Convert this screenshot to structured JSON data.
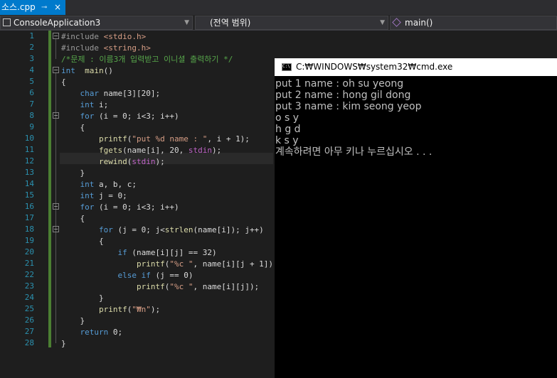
{
  "tab": {
    "file_name": "소스.cpp",
    "pin_glyph": "⊸",
    "close_glyph": "×"
  },
  "navbar": {
    "project": "ConsoleApplication3",
    "scope": "(전역 범위)",
    "member": "main()"
  },
  "editor": {
    "line_numbers": [
      "1",
      "2",
      "3",
      "4",
      "5",
      "6",
      "7",
      "8",
      "9",
      "10",
      "11",
      "12",
      "13",
      "14",
      "15",
      "16",
      "17",
      "18",
      "19",
      "20",
      "21",
      "22",
      "23",
      "24",
      "25",
      "26",
      "27",
      "28"
    ],
    "lines": [
      [
        [
          "inc",
          "#include "
        ],
        [
          "str",
          "<stdio.h>"
        ]
      ],
      [
        [
          "inc",
          "#include "
        ],
        [
          "str",
          "<string.h>"
        ]
      ],
      [
        [
          "cm",
          "/*문제 : 이름3개 입력받고 이니셜 출력하기 */"
        ]
      ],
      [
        [
          "kw",
          "int"
        ],
        [
          "",
          "  "
        ],
        [
          "fn",
          "main"
        ],
        [
          "",
          "()"
        ]
      ],
      [
        [
          "",
          "{"
        ]
      ],
      [
        [
          "",
          "    "
        ],
        [
          "kw",
          "char"
        ],
        [
          "",
          " name[3][20];"
        ]
      ],
      [
        [
          "",
          "    "
        ],
        [
          "kw",
          "int"
        ],
        [
          "",
          " i;"
        ]
      ],
      [
        [
          "",
          "    "
        ],
        [
          "kw",
          "for"
        ],
        [
          "",
          " (i = 0; i<3; i++)"
        ]
      ],
      [
        [
          "",
          "    {"
        ]
      ],
      [
        [
          "",
          "        "
        ],
        [
          "fn",
          "printf"
        ],
        [
          "",
          "("
        ],
        [
          "str",
          "\"put %d name : \""
        ],
        [
          "",
          ", i + 1);"
        ]
      ],
      [
        [
          "",
          "        "
        ],
        [
          "fn",
          "fgets"
        ],
        [
          "",
          "(name[i], 20, "
        ],
        [
          "mac",
          "stdin"
        ],
        [
          "",
          ");"
        ]
      ],
      [
        [
          "",
          "        "
        ],
        [
          "fn",
          "rewind"
        ],
        [
          "",
          "("
        ],
        [
          "mac",
          "stdin"
        ],
        [
          "",
          ");"
        ]
      ],
      [
        [
          "",
          "    }"
        ]
      ],
      [
        [
          "",
          "    "
        ],
        [
          "kw",
          "int"
        ],
        [
          "",
          " a, b, c;"
        ]
      ],
      [
        [
          "",
          "    "
        ],
        [
          "kw",
          "int"
        ],
        [
          "",
          " j = 0;"
        ]
      ],
      [
        [
          "",
          "    "
        ],
        [
          "kw",
          "for"
        ],
        [
          "",
          " (i = 0; i<3; i++)"
        ]
      ],
      [
        [
          "",
          "    {"
        ]
      ],
      [
        [
          "",
          "        "
        ],
        [
          "kw",
          "for"
        ],
        [
          "",
          " (j = 0; j<"
        ],
        [
          "fn",
          "strlen"
        ],
        [
          "",
          "(name[i]); j++)"
        ]
      ],
      [
        [
          "",
          "        {"
        ]
      ],
      [
        [
          "",
          "            "
        ],
        [
          "kw",
          "if"
        ],
        [
          "",
          " (name[i][j] == 32)"
        ]
      ],
      [
        [
          "",
          "                "
        ],
        [
          "fn",
          "printf"
        ],
        [
          "",
          "("
        ],
        [
          "str",
          "\"%c \""
        ],
        [
          "",
          ", name[i][j + 1]);"
        ]
      ],
      [
        [
          "",
          "            "
        ],
        [
          "kw",
          "else if"
        ],
        [
          "",
          " (j == 0)"
        ]
      ],
      [
        [
          "",
          "                "
        ],
        [
          "fn",
          "printf"
        ],
        [
          "",
          "("
        ],
        [
          "str",
          "\"%c \""
        ],
        [
          "",
          ", name[i][j]);"
        ]
      ],
      [
        [
          "",
          "        }"
        ]
      ],
      [
        [
          "",
          "        "
        ],
        [
          "fn",
          "printf"
        ],
        [
          "",
          "("
        ],
        [
          "str",
          "\"₩n\""
        ],
        [
          "",
          ");"
        ]
      ],
      [
        [
          "",
          "    }"
        ]
      ],
      [
        [
          "",
          "    "
        ],
        [
          "kw",
          "return"
        ],
        [
          "",
          " 0;"
        ]
      ],
      [
        [
          "",
          "}"
        ]
      ]
    ]
  },
  "console": {
    "title": "C:₩WINDOWS₩system32₩cmd.exe",
    "icon_text": "C:\\",
    "lines": [
      "put 1 name : oh su yeong",
      "put 2 name : hong gil dong",
      "put 3 name : kim seong yeop",
      "o s y",
      "h g d",
      "k s y",
      "계속하려면 아무 키나 누르십시오 . . ."
    ]
  },
  "colors": {
    "accent": "#007acc",
    "keyword": "#569cd6",
    "string": "#d69d85",
    "comment": "#57a64a",
    "function": "#dcdcaa",
    "line_number": "#2b91af",
    "change_bar": "#4b7f32"
  }
}
